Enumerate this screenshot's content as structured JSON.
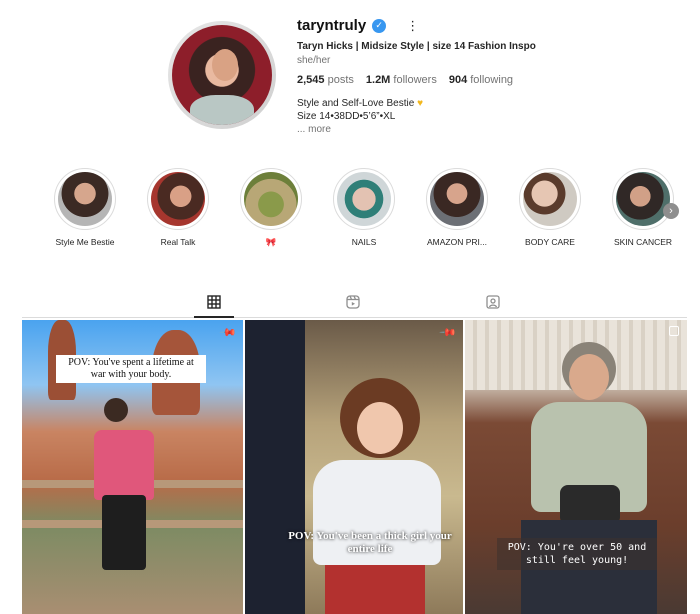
{
  "profile": {
    "username": "taryntruly",
    "full_name": "Taryn Hicks | Midsize Style | size 14 Fashion Inspo",
    "pronouns": "she/her",
    "stats": {
      "posts_num": "2,545",
      "posts_label": "posts",
      "followers_num": "1.2M",
      "followers_label": "followers",
      "following_num": "904",
      "following_label": "following"
    },
    "bio_line1": "Style and Self-Love Bestie",
    "bio_line2": "Size 14•38DD•5’6”•XL",
    "bio_more": "... more",
    "icons": {
      "verified": "verified-badge-icon",
      "options": "more-options-icon",
      "heart": "yellow-heart-icon"
    },
    "accent_color": "#3897f0"
  },
  "highlights": [
    {
      "label": "Style Me Bestie"
    },
    {
      "label": "Real Talk"
    },
    {
      "label": "🎀"
    },
    {
      "label": "NAILS"
    },
    {
      "label": "AMAZON PRI..."
    },
    {
      "label": "BODY CARE"
    },
    {
      "label": "SKIN CANCER"
    }
  ],
  "tabs": [
    {
      "name": "posts-grid-icon",
      "active": true
    },
    {
      "name": "reels-icon",
      "active": false
    },
    {
      "name": "tagged-icon",
      "active": false
    }
  ],
  "posts": [
    {
      "caption": "POV: You've spent a lifetime at war with your body.",
      "badge": "pin-icon"
    },
    {
      "caption": "POV: You've been a thick girl your entire life",
      "badge": "pin-icon"
    },
    {
      "caption": "POV: You're over 50 and still feel young!",
      "badge": "carousel-icon"
    }
  ]
}
